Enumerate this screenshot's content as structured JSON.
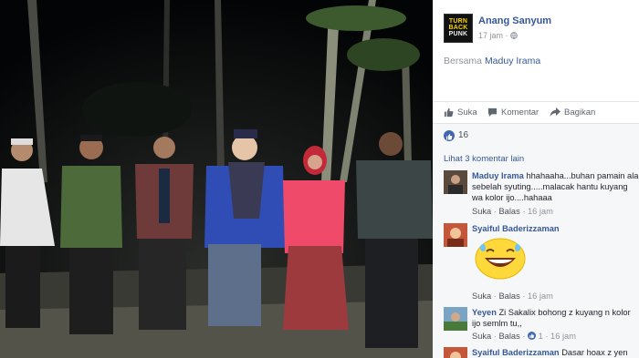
{
  "post": {
    "author": "Anang Sanyum",
    "time": "17 jam",
    "privacy_icon": "globe-icon",
    "with_prefix": "Bersama",
    "with_name": "Maduy Irama",
    "avatar_lines": [
      "TURN",
      "BACK",
      "PUNK"
    ]
  },
  "actions": {
    "like": "Suka",
    "comment": "Komentar",
    "share": "Bagikan"
  },
  "reactions": {
    "count": "16"
  },
  "comments": {
    "more_link": "Lihat 3 komentar lain",
    "items": [
      {
        "name": "Maduy Irama",
        "text": "hhahaaha...buhan pamain ala sebelah syuting.....malacak hantu kuyang wa kolor ijo....hahaaa",
        "like": "Suka",
        "reply": "Balas",
        "time": "16 jam"
      },
      {
        "name": "Syaiful Baderizzaman",
        "text": "",
        "sticker": "laughing-emoji",
        "like": "Suka",
        "reply": "Balas",
        "time": "16 jam"
      },
      {
        "name": "Yeyen",
        "text": "Zi Sakalix bohong z kuyang n kolor ijo semlm tu,,",
        "like": "Suka",
        "reply": "Balas",
        "reaction_count": "1",
        "time": "16 jam"
      },
      {
        "name": "Syaiful Baderizzaman",
        "text": "Dasar hoax z yen ae..."
      }
    ]
  },
  "colors": {
    "link": "#365899",
    "meta": "#90949c",
    "like_blue": "#4267b2"
  }
}
